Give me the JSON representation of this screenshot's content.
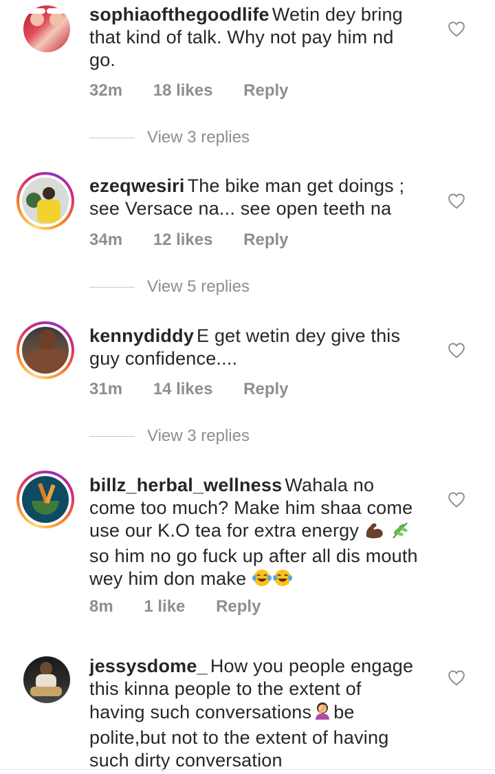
{
  "comments": [
    {
      "username": "sophiaofthegoodlife",
      "text": "Wetin dey bring that kind of talk. Why not pay him nd go.",
      "time": "32m",
      "likes": "18 likes",
      "reply": "Reply",
      "view_replies": "View 3 replies"
    },
    {
      "username": "ezeqwesiri",
      "text": "The bike man get doings ; see Versace na... see open teeth na",
      "time": "34m",
      "likes": "12 likes",
      "reply": "Reply",
      "view_replies": "View 5 replies"
    },
    {
      "username": "kennydiddy",
      "text": "E get wetin dey give this guy confidence....",
      "time": "31m",
      "likes": "14 likes",
      "reply": "Reply",
      "view_replies": "View 3 replies"
    },
    {
      "username": "billz_herbal_wellness",
      "text_parts": [
        "Wahala no come too much?  Make him shaa come use our K.O tea for extra energy ",
        " so him no go fuck up after all dis mouth wey him don make "
      ],
      "time": "8m",
      "likes": "1 like",
      "reply": "Reply"
    },
    {
      "username": "jessysdome_",
      "text_parts": [
        "How you people engage this kinna people to the extent of having such conversations",
        "be polite,but not to the extent of having such dirty conversation"
      ]
    }
  ],
  "icons": {
    "heart": "heart-outline-icon",
    "muscle": "flexed-biceps-emoji",
    "herb": "herb-emoji",
    "laugh": "tears-of-joy-emoji",
    "facepalm": "woman-facepalming-emoji"
  },
  "colors": {
    "meta": "#8e8e8e",
    "text": "#262626",
    "ring_start": "#feda75",
    "ring_end": "#d62976"
  }
}
